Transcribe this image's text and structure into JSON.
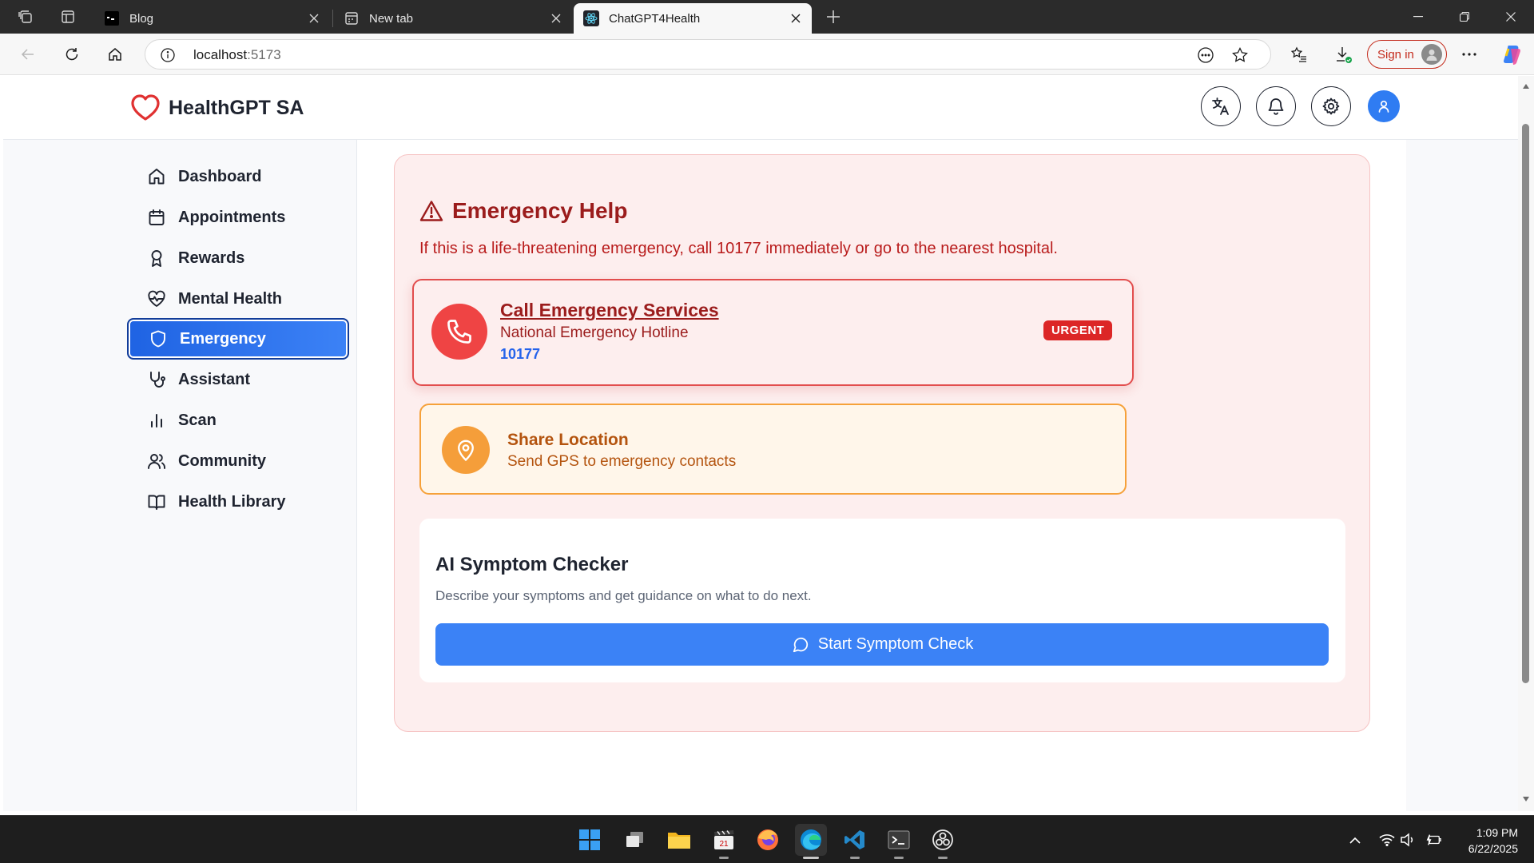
{
  "browser": {
    "tabs": [
      {
        "title": "Blog",
        "active": false
      },
      {
        "title": "New tab",
        "active": false
      },
      {
        "title": "ChatGPT4Health",
        "active": true
      }
    ],
    "address": {
      "host": "localhost",
      "port": ":5173"
    },
    "signin_label": "Sign in"
  },
  "app": {
    "brand": "HealthGPT SA",
    "accent_color": "#2f7cf2",
    "danger_color": "#dc2626",
    "header_icons": [
      "translate-icon",
      "bell-icon",
      "gear-icon",
      "user-icon"
    ]
  },
  "sidebar": {
    "items": [
      {
        "label": "Dashboard",
        "icon": "home-icon"
      },
      {
        "label": "Appointments",
        "icon": "calendar-icon"
      },
      {
        "label": "Rewards",
        "icon": "award-icon"
      },
      {
        "label": "Mental Health",
        "icon": "heart-pulse-icon"
      },
      {
        "label": "Emergency",
        "icon": "shield-icon",
        "active": true
      },
      {
        "label": "Assistant",
        "icon": "stethoscope-icon"
      },
      {
        "label": "Scan",
        "icon": "bar-chart-icon"
      },
      {
        "label": "Community",
        "icon": "users-icon"
      },
      {
        "label": "Health Library",
        "icon": "book-icon"
      }
    ]
  },
  "emergency": {
    "title": "Emergency Help",
    "subtitle": "If this is a life-threatening emergency, call 10177 immediately or go to the nearest hospital.",
    "call_card": {
      "title": "Call Emergency Services",
      "description": "National Emergency Hotline",
      "number": "10177",
      "badge": "URGENT"
    },
    "location_card": {
      "title": "Share Location",
      "description": "Send GPS to emergency contacts"
    },
    "symptom_checker": {
      "title": "AI Symptom Checker",
      "description": "Describe your symptoms and get guidance on what to do next.",
      "button_label": "Start Symptom Check"
    }
  },
  "taskbar": {
    "apps": [
      "windows-start-icon",
      "task-view-icon",
      "file-explorer-icon",
      "clapperboard-icon",
      "firefox-icon",
      "edge-icon",
      "vscode-icon",
      "terminal-icon",
      "obs-icon"
    ],
    "time": "1:09 PM",
    "date": "6/22/2025"
  }
}
